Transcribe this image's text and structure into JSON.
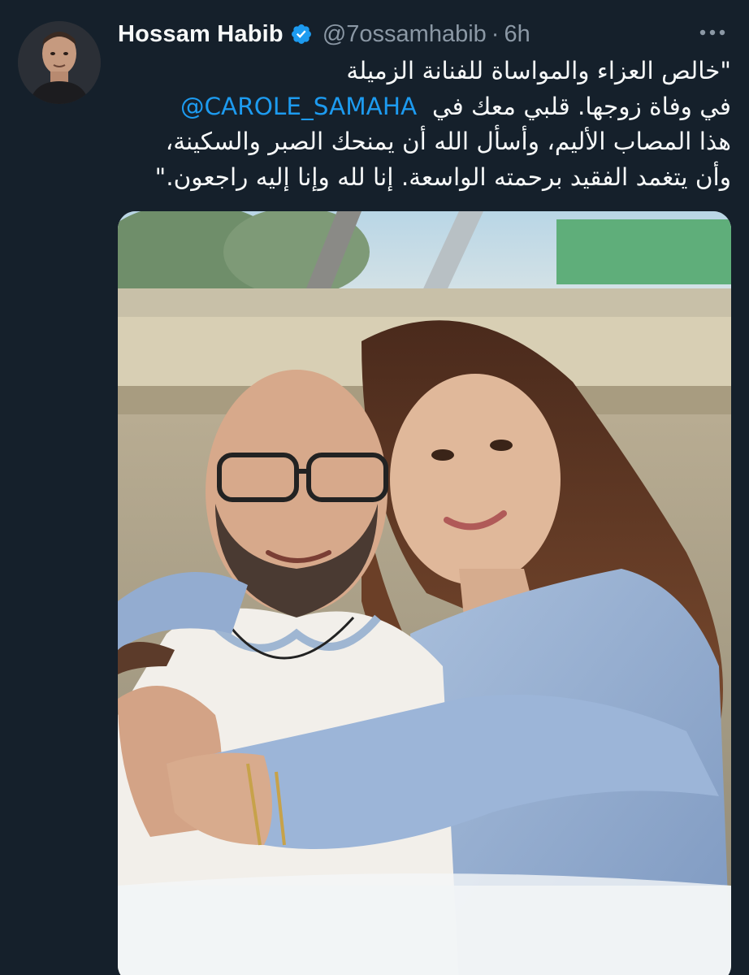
{
  "tweet": {
    "author": {
      "display_name": "Hossam Habib",
      "handle": "@7ossamhabib",
      "verified": true
    },
    "separator": "·",
    "time": "6h",
    "more_icon": "more-horizontal-icon",
    "text_lines": [
      "\"خالص العزاء والمواساة للفنانة الزميلة",
      "في وفاة زوجها. قلبي معك في",
      "هذا المصاب الأليم، وأسأل الله أن يمنحك الصبر والسكينة،",
      "وأن يتغمد الفقيد برحمته الواسعة. إنا لله وإنا إليه راجعون.\""
    ],
    "mention": "@CAROLE_SAMAHA",
    "colors": {
      "background": "#15202b",
      "text": "#f7f9f9",
      "secondary_text": "#8b98a5",
      "link": "#1d9bf0",
      "verified": "#1d9bf0"
    }
  }
}
